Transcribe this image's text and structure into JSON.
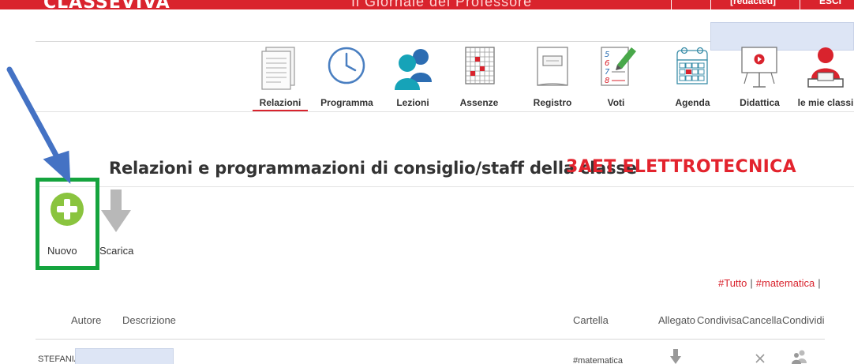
{
  "header": {
    "brand": "CLASSEVIVA",
    "title": "Il Giornale del Professore",
    "user": "[redacted]",
    "exit": "ESCI"
  },
  "nav": {
    "items": [
      {
        "id": "relazioni",
        "label": "Relazioni",
        "icon": "document-list-icon",
        "active": true
      },
      {
        "id": "programma",
        "label": "Programma",
        "icon": "clock-icon",
        "active": false
      },
      {
        "id": "lezioni",
        "label": "Lezioni",
        "icon": "people-icon",
        "active": false
      },
      {
        "id": "assenze",
        "label": "Assenze",
        "icon": "calendar-grid-icon",
        "active": false
      },
      {
        "id": "registro",
        "label": "Registro",
        "icon": "register-book-icon",
        "active": false
      },
      {
        "id": "voti",
        "label": "Voti",
        "icon": "grades-pen-icon",
        "active": false
      },
      {
        "id": "agenda",
        "label": "Agenda",
        "icon": "agenda-calendar-icon",
        "active": false
      },
      {
        "id": "didattica",
        "label": "Didattica",
        "icon": "presentation-board-icon",
        "active": false
      },
      {
        "id": "mie-classi",
        "label": "le mie classi",
        "icon": "teacher-icon",
        "active": false
      }
    ]
  },
  "page": {
    "title": "Relazioni e programmazioni di consiglio/staff della classe",
    "class_name": "3AET ELETTROTECNICA"
  },
  "actions": {
    "nuovo": "Nuovo",
    "scarica": "Scarica"
  },
  "filters": {
    "all": "#Tutto",
    "matematica": "#matematica"
  },
  "table": {
    "headers": {
      "autore": "Autore",
      "descrizione": "Descrizione",
      "cartella": "Cartella",
      "allegato": "Allegato",
      "condivisa": "Condivisa",
      "cancella": "Cancella",
      "condividi": "Condividi"
    },
    "rows": [
      {
        "autore": "STEFANIA",
        "cartella": "#matematica"
      }
    ]
  },
  "colors": {
    "accent_red": "#d9232d",
    "green_frame": "#15a43e",
    "plus_green": "#8ac43f",
    "arrow_blue": "#4472c4"
  }
}
